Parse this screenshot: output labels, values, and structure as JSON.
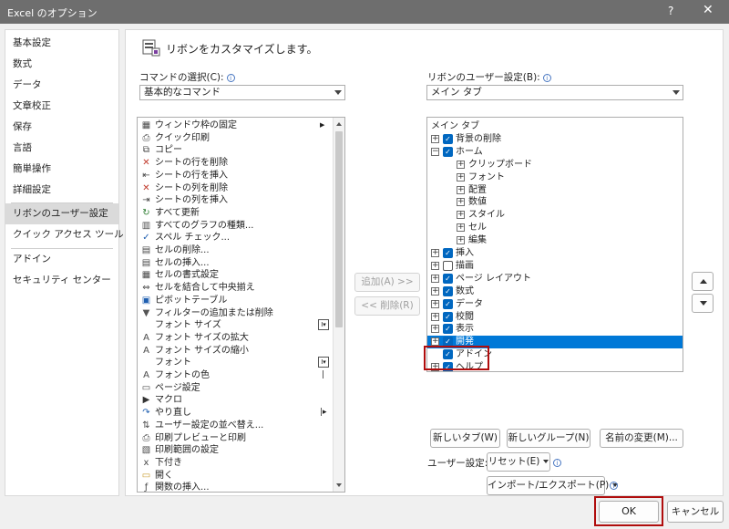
{
  "window": {
    "title": "Excel のオプション",
    "help_label": "?",
    "close_label": "✕"
  },
  "sidebar": {
    "items": [
      {
        "label": "基本設定"
      },
      {
        "label": "数式"
      },
      {
        "label": "データ"
      },
      {
        "label": "文章校正"
      },
      {
        "label": "保存"
      },
      {
        "label": "言語"
      },
      {
        "label": "簡単操作"
      },
      {
        "label": "詳細設定"
      },
      {
        "label": "リボンのユーザー設定",
        "selected": true
      },
      {
        "label": "クイック アクセス ツール バー"
      },
      {
        "label": "アドイン"
      },
      {
        "label": "セキュリティ センター"
      }
    ]
  },
  "main": {
    "heading": "リボンをカスタマイズします。",
    "commands_label": "コマンドの選択(C):",
    "commands_select": "基本的なコマンド",
    "ribbon_label": "リボンのユーザー設定(B):",
    "ribbon_select": "メイン タブ",
    "info_glyph": "i"
  },
  "commands": [
    {
      "label": "ウィンドウ枠の固定",
      "icon": "freeze-panes-icon",
      "trail": "arrow"
    },
    {
      "label": "クイック印刷",
      "icon": "quick-print-icon"
    },
    {
      "label": "コピー",
      "icon": "copy-icon"
    },
    {
      "label": "シートの行を削除",
      "icon": "delete-rows-icon"
    },
    {
      "label": "シートの行を挿入",
      "icon": "insert-rows-icon"
    },
    {
      "label": "シートの列を削除",
      "icon": "delete-columns-icon"
    },
    {
      "label": "シートの列を挿入",
      "icon": "insert-columns-icon"
    },
    {
      "label": "すべて更新",
      "icon": "refresh-all-icon"
    },
    {
      "label": "すべてのグラフの種類...",
      "icon": "chart-types-icon"
    },
    {
      "label": "スペル チェック...",
      "icon": "spelling-icon"
    },
    {
      "label": "セルの削除...",
      "icon": "delete-cells-icon"
    },
    {
      "label": "セルの挿入...",
      "icon": "insert-cells-icon"
    },
    {
      "label": "セルの書式設定",
      "icon": "format-cells-icon"
    },
    {
      "label": "セルを結合して中央揃え",
      "icon": "merge-center-icon"
    },
    {
      "label": "ピボットテーブル",
      "icon": "pivottable-icon"
    },
    {
      "label": "フィルターの追加または削除",
      "icon": "filter-icon"
    },
    {
      "label": "フォント サイズ",
      "icon": "",
      "trail": "subbox"
    },
    {
      "label": "フォント サイズの拡大",
      "icon": "font-grow-icon"
    },
    {
      "label": "フォント サイズの縮小",
      "icon": "font-shrink-icon"
    },
    {
      "label": "フォント",
      "icon": "",
      "trail": "subbox"
    },
    {
      "label": "フォントの色",
      "icon": "font-color-icon",
      "trail": "bar"
    },
    {
      "label": "ページ設定",
      "icon": "page-setup-icon"
    },
    {
      "label": "マクロ",
      "icon": "macro-icon"
    },
    {
      "label": "やり直し",
      "icon": "redo-icon",
      "trail": "bararrow"
    },
    {
      "label": "ユーザー設定の並べ替え...",
      "icon": "custom-sort-icon"
    },
    {
      "label": "印刷プレビューと印刷",
      "icon": "print-preview-icon"
    },
    {
      "label": "印刷範囲の設定",
      "icon": "print-area-icon"
    },
    {
      "label": "下付き",
      "icon": "subscript-icon"
    },
    {
      "label": "開く",
      "icon": "open-icon"
    },
    {
      "label": "関数の挿入...",
      "icon": "insert-function-icon"
    }
  ],
  "buttons": {
    "add": "追加(A) >>",
    "remove": "<< 削除(R)",
    "new_tab": "新しいタブ(W)",
    "new_group": "新しいグループ(N)",
    "rename": "名前の変更(M)...",
    "customize_label": "ユーザー設定:",
    "reset": "リセット(E)",
    "import_export": "インポート/エクスポート(P)",
    "ok": "OK",
    "cancel": "キャンセル"
  },
  "ribbon_tree": [
    {
      "label": "メイン タブ",
      "level": 0,
      "toggle": "",
      "checked": null
    },
    {
      "label": "背景の削除",
      "level": 1,
      "toggle": "+",
      "checked": true
    },
    {
      "label": "ホーム",
      "level": 1,
      "toggle": "−",
      "checked": true
    },
    {
      "label": "クリップボード",
      "level": 2,
      "toggle": "+",
      "checked": null
    },
    {
      "label": "フォント",
      "level": 2,
      "toggle": "+",
      "checked": null
    },
    {
      "label": "配置",
      "level": 2,
      "toggle": "+",
      "checked": null
    },
    {
      "label": "数値",
      "level": 2,
      "toggle": "+",
      "checked": null
    },
    {
      "label": "スタイル",
      "level": 2,
      "toggle": "+",
      "checked": null
    },
    {
      "label": "セル",
      "level": 2,
      "toggle": "+",
      "checked": null
    },
    {
      "label": "編集",
      "level": 2,
      "toggle": "+",
      "checked": null
    },
    {
      "label": "挿入",
      "level": 1,
      "toggle": "+",
      "checked": true
    },
    {
      "label": "描画",
      "level": 1,
      "toggle": "+",
      "checked": false
    },
    {
      "label": "ページ レイアウト",
      "level": 1,
      "toggle": "+",
      "checked": true
    },
    {
      "label": "数式",
      "level": 1,
      "toggle": "+",
      "checked": true
    },
    {
      "label": "データ",
      "level": 1,
      "toggle": "+",
      "checked": true
    },
    {
      "label": "校閲",
      "level": 1,
      "toggle": "+",
      "checked": true
    },
    {
      "label": "表示",
      "level": 1,
      "toggle": "+",
      "checked": true
    },
    {
      "label": "開発",
      "level": 1,
      "toggle": "+",
      "checked": true,
      "selected": true
    },
    {
      "label": "アドイン",
      "level": 1,
      "toggle": "",
      "checked": true
    },
    {
      "label": "ヘルプ",
      "level": 1,
      "toggle": "+",
      "checked": true
    }
  ],
  "colors": {
    "selection": "#0078d7",
    "highlight": "#b00d0d",
    "checkbox": "#0067c0"
  }
}
